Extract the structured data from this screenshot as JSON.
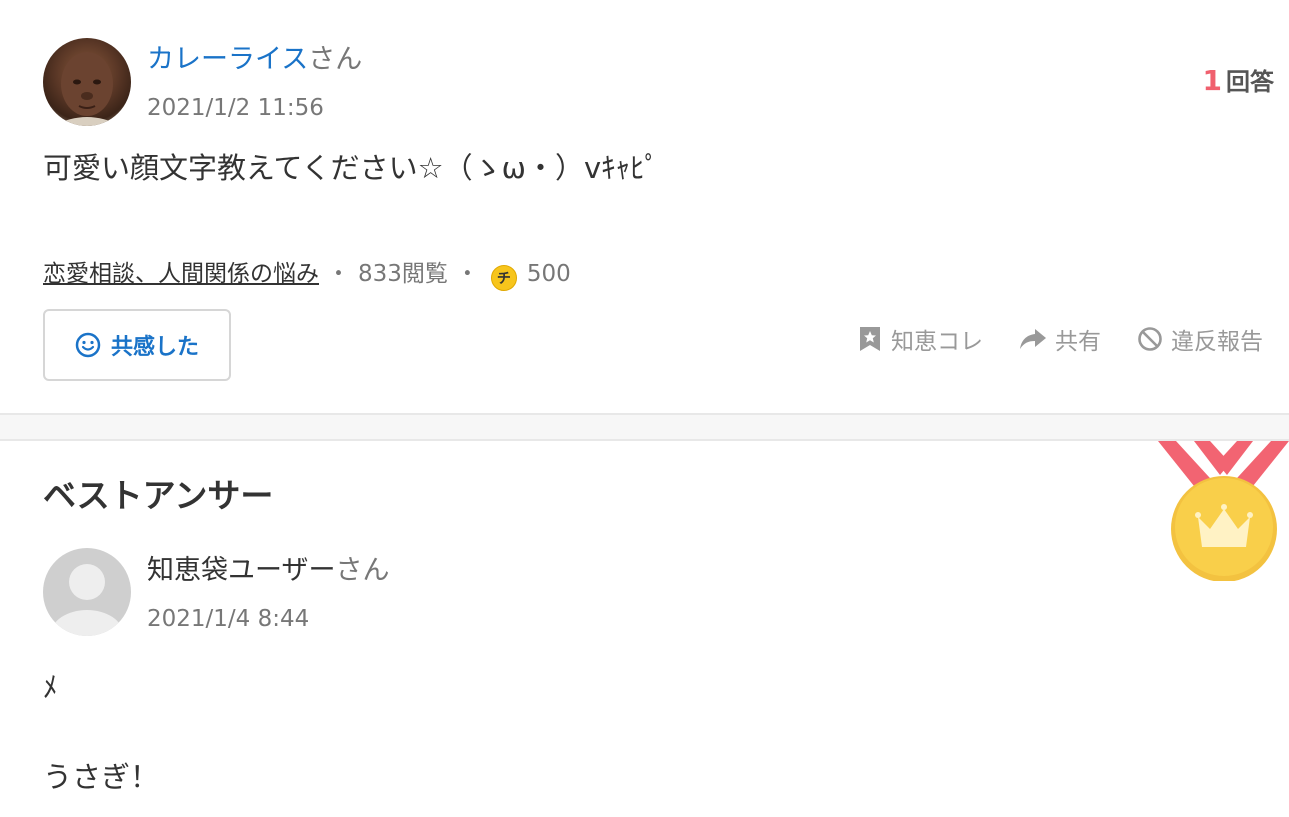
{
  "question": {
    "author_name": "カレーライス",
    "author_suffix": "さん",
    "date": "2021/1/2 11:56",
    "answer_count": "1",
    "answer_label": "回答",
    "text": "可愛い顔文字教えてください☆（ゝω・）vｷｬﾋﾟ",
    "category": "恋愛相談、人間関係の悩み",
    "views": "833閲覧",
    "coin_symbol": "チ",
    "coin_amount": "500",
    "empathy_label": "共感した",
    "actions": {
      "bookmark": "知恵コレ",
      "share": "共有",
      "report": "違反報告"
    }
  },
  "best_answer": {
    "title": "ベストアンサー",
    "author_name": "知恵袋ユーザー",
    "author_suffix": "さん",
    "date": "2021/1/4 8:44",
    "line1": "ﾒ",
    "line2": "うさぎ！"
  },
  "colors": {
    "link_blue": "#1a73c8",
    "answer_count_red": "#f0606e",
    "medal_ribbon": "#f26472",
    "medal_gold": "#f9cf4a",
    "coin_yellow": "#f7c51c"
  },
  "icons": [
    "user-photo-icon",
    "smile-icon",
    "bookmark-icon",
    "share-arrow-icon",
    "prohibited-icon",
    "coin-icon",
    "medal-icon",
    "crown-icon",
    "default-avatar-icon"
  ]
}
